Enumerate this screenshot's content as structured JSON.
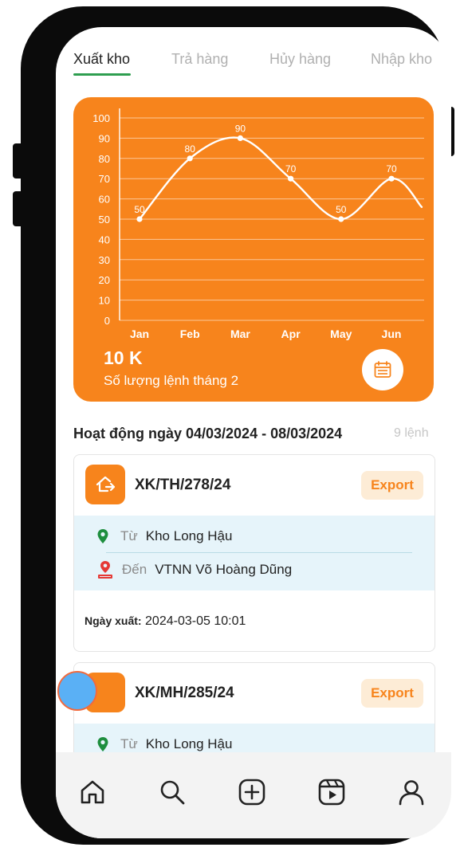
{
  "tabs": [
    {
      "label": "Xuất kho",
      "active": true
    },
    {
      "label": "Trả hàng",
      "active": false
    },
    {
      "label": "Hủy hàng",
      "active": false
    },
    {
      "label": "Nhập kho",
      "active": false
    }
  ],
  "summary": {
    "value": "10 K",
    "label": "Số lượng lệnh tháng 2",
    "calendar_icon": "calendar-icon"
  },
  "chart_data": {
    "type": "line",
    "categories": [
      "Jan",
      "Feb",
      "Mar",
      "Apr",
      "May",
      "Jun"
    ],
    "series": [
      {
        "values": [
          50,
          80,
          90,
          70,
          50,
          70
        ]
      }
    ],
    "data_labels": [
      "50",
      "80",
      "90",
      "70",
      "50",
      "70"
    ],
    "ylim": [
      0,
      100
    ],
    "yticks": [
      "0",
      "10",
      "20",
      "30",
      "40",
      "50",
      "60",
      "70",
      "80",
      "90",
      "100"
    ],
    "title": "",
    "xlabel": "",
    "ylabel": "",
    "grid": true,
    "background": "#f7841c",
    "line_color": "#ffffff"
  },
  "activity": {
    "title": "Hoạt động ngày 04/03/2024 - 08/03/2024",
    "count": "9 lệnh"
  },
  "orders": [
    {
      "code": "XK/TH/278/24",
      "badge": "Export",
      "from_prefix": "Từ",
      "from": "Kho Long Hậu",
      "to_prefix": "Đến",
      "to": "VTNN Võ Hoàng Dũng",
      "date_label": "Ngày xuất:",
      "date": "2024-03-05 10:01"
    },
    {
      "code": "XK/MH/285/24",
      "badge": "Export",
      "from_prefix": "Từ",
      "from": "Kho Long Hậu"
    }
  ],
  "nav": [
    "home-icon",
    "search-icon",
    "add-icon",
    "reels-icon",
    "profile-icon"
  ],
  "colors": {
    "accent": "#f7841c",
    "tab_active": "#2e9e4f",
    "route_bg": "#e6f4fa",
    "from_pin": "#1e8e3e",
    "to_pin": "#e53935"
  }
}
